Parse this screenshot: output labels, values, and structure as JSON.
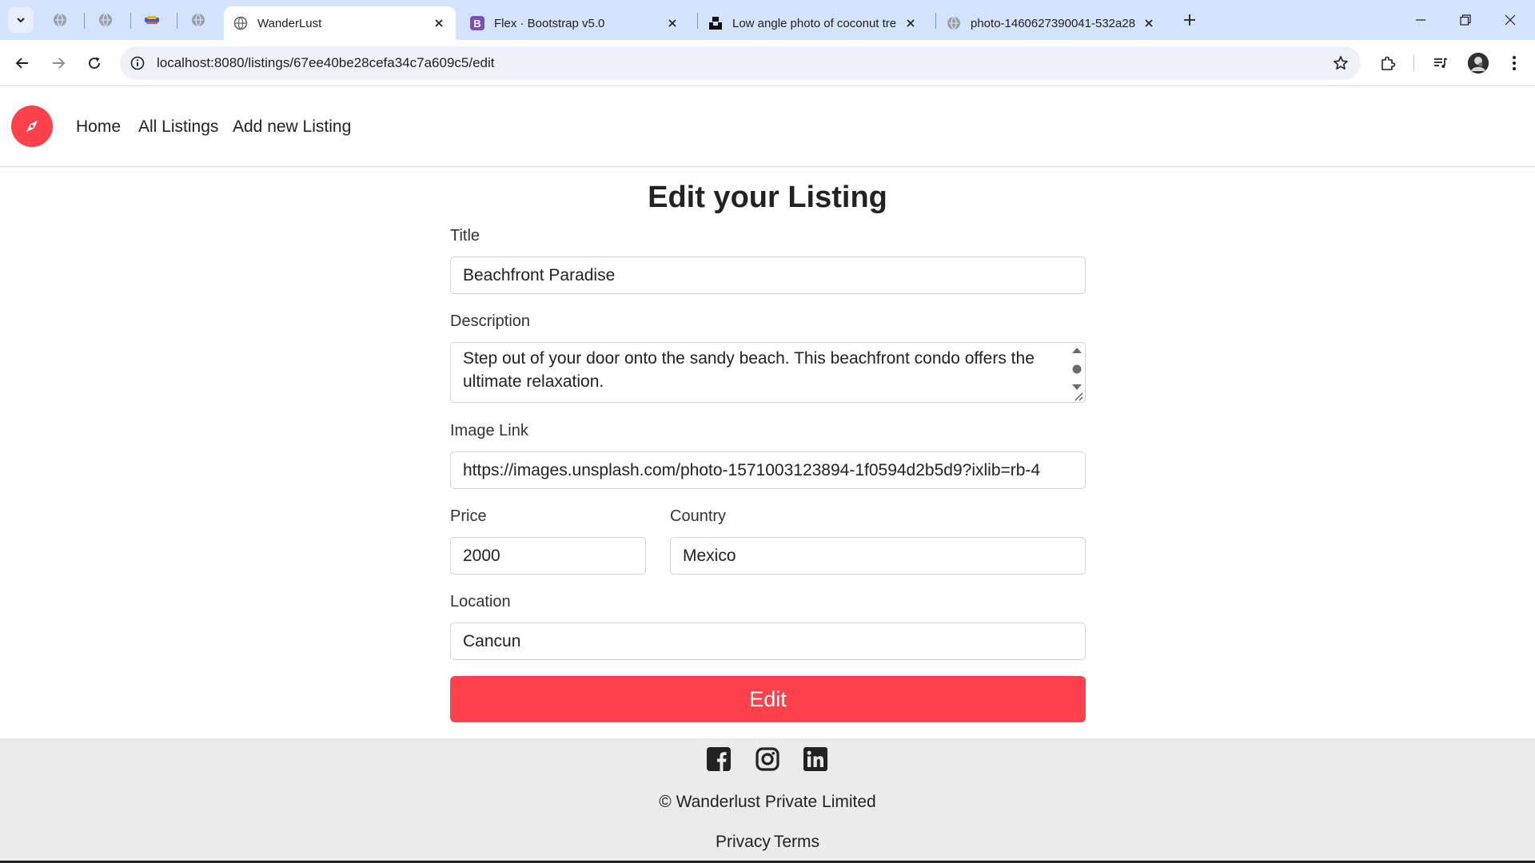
{
  "browser": {
    "tabs": [
      {
        "title": "WanderLust",
        "active": true
      },
      {
        "title": "Flex · Bootstrap v5.0",
        "active": false
      },
      {
        "title": "Low angle photo of coconut tre",
        "active": false
      },
      {
        "title": "photo-1460627390041-532a28",
        "active": false
      }
    ],
    "url": "localhost:8080/listings/67ee40be28cefa34c7a609c5/edit"
  },
  "navbar": {
    "brand_icon": "compass-icon",
    "links": [
      "Home",
      "All Listings",
      "Add new Listing"
    ]
  },
  "form": {
    "heading": "Edit your Listing",
    "title_label": "Title",
    "title_value": "Beachfront Paradise",
    "description_label": "Description",
    "description_value": "Step out of your door onto the sandy beach. This beachfront condo offers the ultimate relaxation.",
    "image_label": "Image Link",
    "image_value": "https://images.unsplash.com/photo-1571003123894-1f0594d2b5d9?ixlib=rb-4",
    "price_label": "Price",
    "price_value": "2000",
    "country_label": "Country",
    "country_value": "Mexico",
    "location_label": "Location",
    "location_value": "Cancun",
    "submit_label": "Edit"
  },
  "footer": {
    "social_icons": [
      "facebook-icon",
      "instagram-icon",
      "linkedin-icon"
    ],
    "copyright": "© Wanderlust Private Limited",
    "links": [
      "Privacy",
      "Terms"
    ]
  },
  "colors": {
    "brand": "#fe424d",
    "tabstrip": "#d3e3fd",
    "footer_bg": "#ebebeb"
  }
}
